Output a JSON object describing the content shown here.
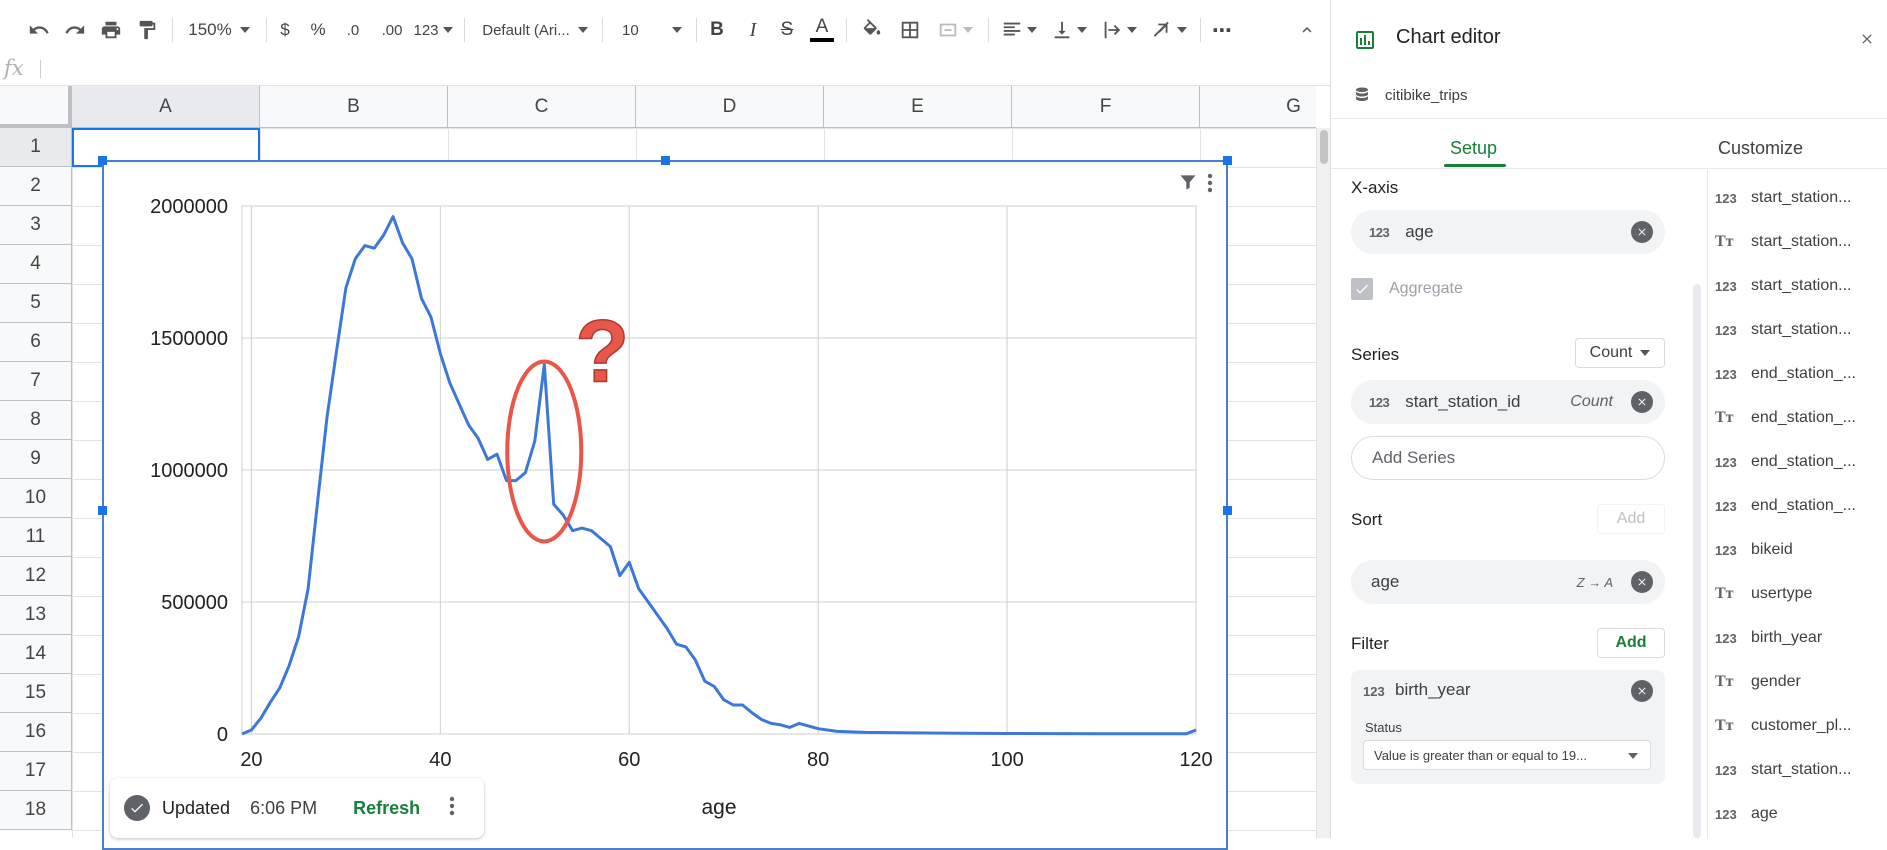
{
  "toolbar": {
    "zoom": "150%",
    "currency": "$",
    "percent": "%",
    "dec_decrease": ".0",
    "dec_increase": ".00",
    "number_format": "123",
    "font": "Default (Ari...",
    "font_size": "10",
    "bold": "B",
    "italic": "I",
    "strike": "S",
    "text_color": "A",
    "more": "⋯"
  },
  "formula_bar": {
    "fx": "fx"
  },
  "grid": {
    "columns": [
      "A",
      "B",
      "C",
      "D",
      "E",
      "F",
      "G"
    ],
    "rows": [
      "1",
      "2",
      "3",
      "4",
      "5",
      "6",
      "7",
      "8",
      "9",
      "10",
      "11",
      "12",
      "13",
      "14",
      "15",
      "16",
      "17",
      "18"
    ]
  },
  "chart_data": {
    "type": "line",
    "title": "",
    "xlabel": "age",
    "ylabel": "",
    "xlim": [
      19,
      120
    ],
    "ylim": [
      0,
      2000000
    ],
    "x_ticks": [
      "20",
      "40",
      "60",
      "80",
      "100",
      "120"
    ],
    "y_ticks": [
      "0",
      "500000",
      "1000000",
      "1500000",
      "2000000"
    ],
    "grid": true,
    "legend": "none",
    "line_color": "#3c78d8",
    "annotation": {
      "text": "?",
      "color": "#e8574a",
      "target_x": 51,
      "target_y": 1390000
    },
    "series": [
      {
        "x": [
          19,
          20,
          21,
          22,
          23,
          24,
          25,
          26,
          27,
          28,
          29,
          30,
          31,
          32,
          33,
          34,
          35,
          36,
          37,
          38,
          39,
          40,
          41,
          42,
          43,
          44,
          45,
          46,
          47,
          48,
          49,
          50,
          51,
          52,
          53,
          54,
          55,
          56,
          57,
          58,
          59,
          60,
          61,
          62,
          63,
          64,
          65,
          66,
          67,
          68,
          69,
          70,
          71,
          72,
          73,
          74,
          75,
          76,
          77,
          78,
          79,
          80,
          82,
          85,
          90,
          95,
          100,
          105,
          110,
          115,
          119,
          120
        ],
        "values": [
          0,
          15000,
          60000,
          120000,
          175000,
          260000,
          370000,
          550000,
          880000,
          1200000,
          1450000,
          1690000,
          1800000,
          1850000,
          1840000,
          1890000,
          1960000,
          1860000,
          1800000,
          1650000,
          1580000,
          1440000,
          1330000,
          1250000,
          1170000,
          1120000,
          1040000,
          1060000,
          960000,
          960000,
          990000,
          1110000,
          1400000,
          870000,
          830000,
          770000,
          780000,
          770000,
          740000,
          710000,
          600000,
          650000,
          550000,
          500000,
          450000,
          400000,
          340000,
          330000,
          280000,
          200000,
          180000,
          130000,
          110000,
          110000,
          80000,
          55000,
          40000,
          35000,
          25000,
          40000,
          30000,
          20000,
          10000,
          6000,
          4000,
          3000,
          2000,
          1500,
          1000,
          1000,
          1000,
          15000
        ]
      }
    ]
  },
  "updated_bar": {
    "status": "Updated",
    "time": "6:06 PM",
    "refresh": "Refresh"
  },
  "editor": {
    "title": "Chart editor",
    "data_source": "citibike_trips",
    "tabs": {
      "setup": "Setup",
      "customize": "Customize"
    },
    "xaxis": {
      "label": "X-axis",
      "field": "age",
      "type_icon": "123"
    },
    "aggregate": {
      "label": "Aggregate",
      "checked": true
    },
    "series": {
      "label": "Series",
      "aggregation": "Count",
      "field": "start_station_id",
      "field_agg": "Count",
      "type_icon": "123",
      "add": "Add Series"
    },
    "sort": {
      "label": "Sort",
      "add": "Add",
      "field": "age",
      "order": "Z → A"
    },
    "filter": {
      "label": "Filter",
      "add": "Add",
      "field": "birth_year",
      "type_icon": "123",
      "status_label": "Status",
      "status_value": "Value is greater than or equal to 19..."
    },
    "fields": [
      {
        "icon": "123",
        "name": "start_station..."
      },
      {
        "icon": "Tт",
        "name": "start_station..."
      },
      {
        "icon": "123",
        "name": "start_station..."
      },
      {
        "icon": "123",
        "name": "start_station..."
      },
      {
        "icon": "123",
        "name": "end_station_..."
      },
      {
        "icon": "Tт",
        "name": "end_station_..."
      },
      {
        "icon": "123",
        "name": "end_station_..."
      },
      {
        "icon": "123",
        "name": "end_station_..."
      },
      {
        "icon": "123",
        "name": "bikeid"
      },
      {
        "icon": "Tт",
        "name": "usertype"
      },
      {
        "icon": "123",
        "name": "birth_year"
      },
      {
        "icon": "Tт",
        "name": "gender"
      },
      {
        "icon": "Tт",
        "name": "customer_pl..."
      },
      {
        "icon": "123",
        "name": "start_station..."
      },
      {
        "icon": "123",
        "name": "age"
      }
    ]
  }
}
